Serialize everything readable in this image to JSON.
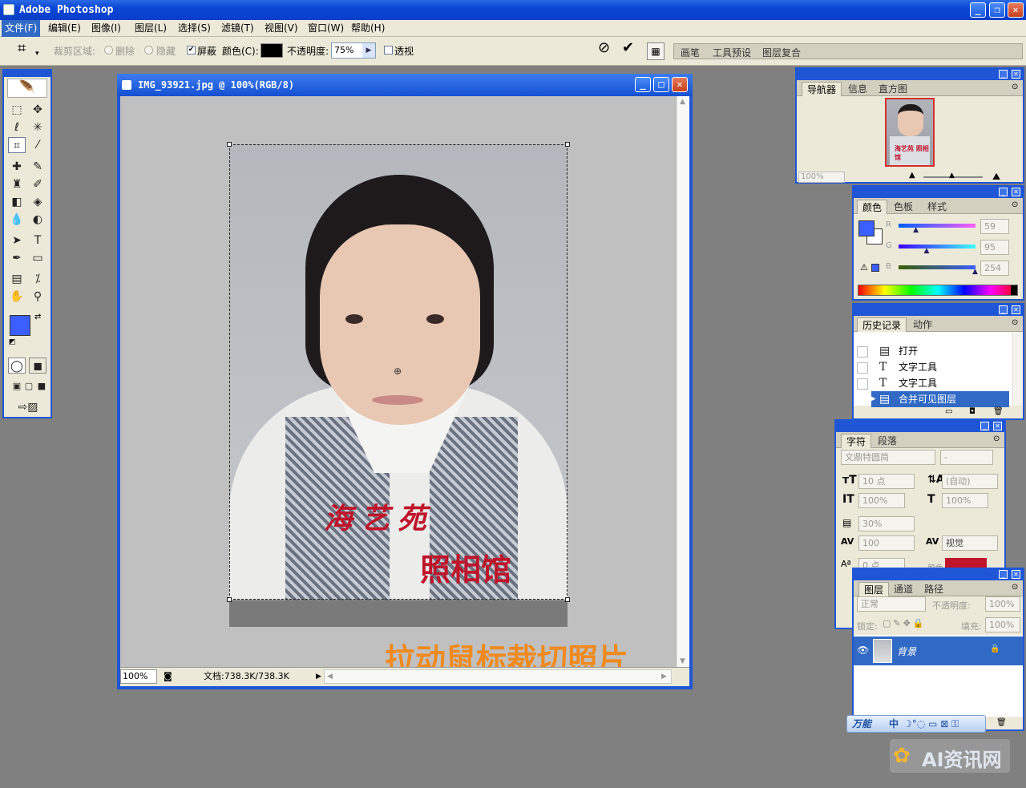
{
  "app": {
    "title": "Adobe Photoshop"
  },
  "menu": [
    "文件(F)",
    "编辑(E)",
    "图像(I)",
    "图层(L)",
    "选择(S)",
    "滤镜(T)",
    "视图(V)",
    "窗口(W)",
    "帮助(H)"
  ],
  "options": {
    "crop_area_label": "裁剪区域:",
    "delete_label": "删除",
    "hide_label": "隐藏",
    "shield_label": "屏蔽",
    "color_label": "颜色(C):",
    "opacity_label": "不透明度:",
    "opacity_value": "75%",
    "perspective_label": "透视",
    "well_tabs": [
      "画笔",
      "工具预设",
      "图层复合"
    ]
  },
  "document": {
    "title": "IMG_93921.jpg @ 100%(RGB/8)",
    "zoom": "100%",
    "doc_size": "文档:738.3K/738.3K",
    "stamp_line1": "海艺苑",
    "stamp_line2": "照相馆",
    "caption": "拉动鼠标裁切照片"
  },
  "navigator": {
    "tabs": [
      "导航器",
      "信息",
      "直方图"
    ],
    "zoom": "100%",
    "mini_stamp": "海艺苑 照相馆"
  },
  "color": {
    "tabs": [
      "颜色",
      "色板",
      "样式"
    ],
    "r_label": "R",
    "g_label": "G",
    "b_label": "B",
    "r": "59",
    "g": "95",
    "b": "254",
    "r_frac": 0.23,
    "g_frac": 0.37,
    "b_frac": 1.0,
    "fg_color": "#3b5ffe"
  },
  "history": {
    "tabs": [
      "历史记录",
      "动作"
    ],
    "items": [
      {
        "icon": "doc-icon",
        "label": "打开"
      },
      {
        "icon": "text-tool-icon",
        "label": "文字工具"
      },
      {
        "icon": "text-tool-icon",
        "label": "文字工具"
      },
      {
        "icon": "doc-icon",
        "label": "合并可见图层"
      }
    ]
  },
  "character": {
    "tabs": [
      "字符",
      "段落"
    ],
    "font": "文鼎特圆简",
    "style": "-",
    "size": "10 点",
    "leading": "(自动)",
    "vscale": "100%",
    "hscale": "100%",
    "baseline_pct": "30%",
    "tracking": "100",
    "kerning": "视觉",
    "baseline": "0 点",
    "color_label": "颜色"
  },
  "layers": {
    "tabs": [
      "图层",
      "通道",
      "路径"
    ],
    "blend": "正常",
    "opacity_label": "不透明度:",
    "opacity": "100%",
    "lock_label": "锁定:",
    "fill_label": "填充:",
    "fill": "100%",
    "layer_name": "背景"
  },
  "ime": {
    "label": "万能",
    "mode": "中"
  },
  "watermark": "AI资讯网"
}
